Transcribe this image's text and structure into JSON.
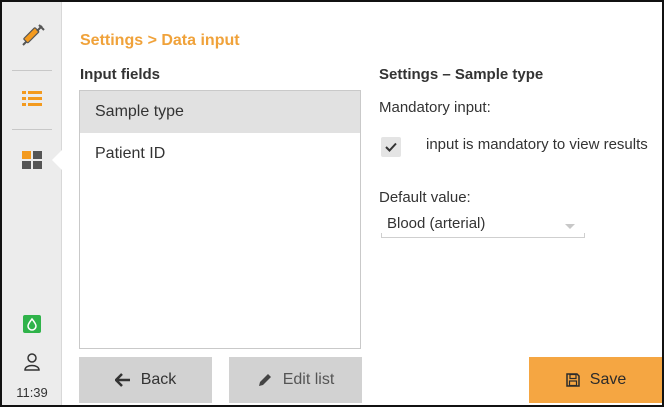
{
  "sidebar": {
    "items": [
      {
        "icon": "syringe-icon",
        "active": false
      },
      {
        "icon": "list-icon",
        "active": false
      },
      {
        "icon": "grid-icon",
        "active": true
      }
    ],
    "status_icon": "drop-icon",
    "user_icon": "user-icon",
    "time": "11:39"
  },
  "header": {
    "breadcrumb": "Settings > Data input"
  },
  "input_fields": {
    "title": "Input fields",
    "items": [
      {
        "label": "Sample type",
        "selected": true
      },
      {
        "label": "Patient ID",
        "selected": false
      }
    ]
  },
  "settings": {
    "title": "Settings – Sample type",
    "mandatory_label": "Mandatory input:",
    "mandatory_checked": true,
    "mandatory_text": "input is mandatory to view results",
    "default_label": "Default value:",
    "default_value": "Blood (arterial)"
  },
  "buttons": {
    "back": "Back",
    "edit_list": "Edit list",
    "save": "Save"
  },
  "colors": {
    "accent": "#f5a642",
    "breadcrumb": "#f0a23a",
    "icon_orange": "#f39a1e",
    "status_green": "#2fb34a"
  }
}
